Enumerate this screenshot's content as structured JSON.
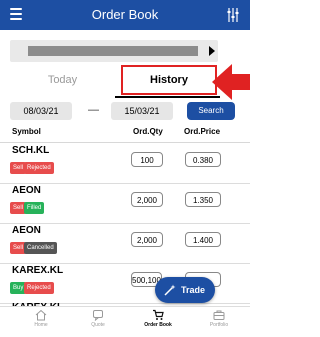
{
  "header": {
    "title": "Order Book",
    "menu_icon": "hamburger-icon",
    "filter_icon": "sliders-icon"
  },
  "account_bar": {
    "masked": true
  },
  "tabs": [
    {
      "label": "Today",
      "active": false
    },
    {
      "label": "History",
      "active": true
    }
  ],
  "date_filter": {
    "from": "08/03/21",
    "separator": "—",
    "to": "15/03/21",
    "search_label": "Search"
  },
  "table": {
    "columns": [
      "Symbol",
      "Ord.Qty",
      "Ord.Price"
    ],
    "rows": [
      {
        "symbol": "SCH.KL",
        "side": "Sell",
        "status": "Rejected",
        "qty": "100",
        "price": "0.380"
      },
      {
        "symbol": "AEON",
        "side": "Sell",
        "status": "Filled",
        "qty": "2,000",
        "price": "1.350"
      },
      {
        "symbol": "AEON",
        "side": "Sell",
        "status": "Cancelled",
        "qty": "2,000",
        "price": "1.400"
      },
      {
        "symbol": "KAREX.KL",
        "side": "Buy",
        "status": "Rejected",
        "qty": "500,100",
        "price": ""
      }
    ],
    "partial_next_symbol": "KAREX.KL"
  },
  "trade_button": {
    "label": "Trade",
    "icon": "wand-icon"
  },
  "bottom_nav": [
    {
      "label": "Home",
      "icon": "home-icon",
      "active": false
    },
    {
      "label": "Quote",
      "icon": "chat-icon",
      "active": false
    },
    {
      "label": "Order Book",
      "icon": "cart-icon",
      "active": true
    },
    {
      "label": "Portfolio",
      "icon": "briefcase-icon",
      "active": false
    }
  ],
  "colors": {
    "primary": "#1d4fa3",
    "sell": "#e74c4c",
    "buy": "#27b25a",
    "filled": "#27b25a",
    "rejected": "#e74c4c",
    "cancelled": "#555555",
    "highlight": "#e02222"
  }
}
